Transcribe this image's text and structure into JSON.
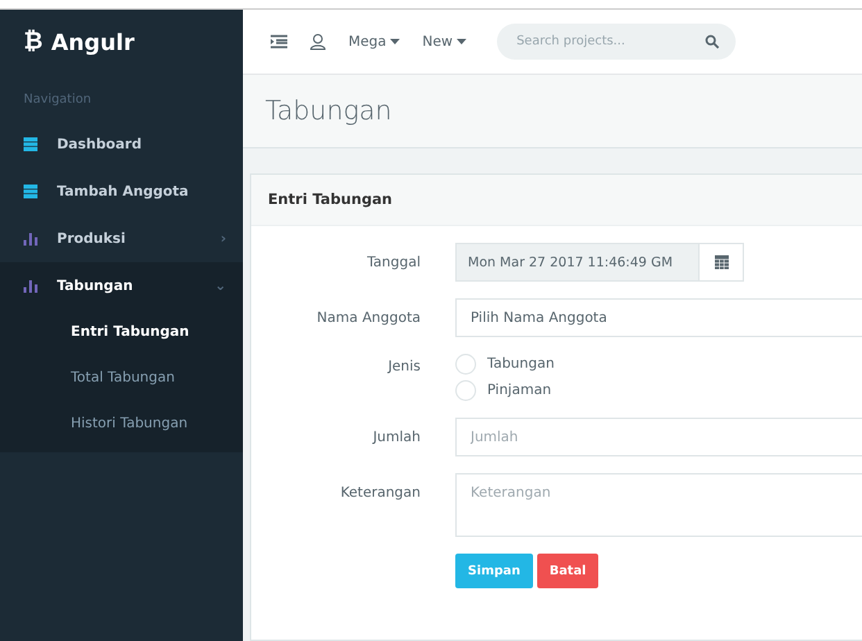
{
  "brand": {
    "logo": "₿",
    "name": "Angulr"
  },
  "sidebar": {
    "heading": "Navigation",
    "items": [
      {
        "label": "Dashboard",
        "kind": "calendar",
        "color": "#23b7e5",
        "expanded": false
      },
      {
        "label": "Tambah Anggota",
        "kind": "calendar",
        "color": "#23b7e5",
        "expanded": false
      },
      {
        "label": "Produksi",
        "kind": "chart",
        "color": "#7266ba",
        "expanded": false,
        "arrow": "›"
      },
      {
        "label": "Tabungan",
        "kind": "chart",
        "color": "#7266ba",
        "expanded": true,
        "arrow": "⌄",
        "children": [
          {
            "label": "Entri Tabungan",
            "selected": true
          },
          {
            "label": "Total Tabungan",
            "selected": false
          },
          {
            "label": "Histori Tabungan",
            "selected": false
          }
        ]
      }
    ]
  },
  "header": {
    "menus": [
      "Mega",
      "New"
    ],
    "search": {
      "placeholder": "Search projects..."
    }
  },
  "page": {
    "title": "Tabungan"
  },
  "panel": {
    "title": "Entri Tabungan",
    "fields": [
      {
        "kind": "date",
        "label": "Tanggal",
        "value": "Mon Mar 27 2017 11:46:49 GM"
      },
      {
        "kind": "text",
        "label": "Nama Anggota",
        "value": "Pilih Nama Anggota"
      },
      {
        "kind": "radio",
        "label": "Jenis",
        "options": [
          {
            "label": "Tabungan",
            "selected": false
          },
          {
            "label": "Pinjaman",
            "selected": false
          }
        ]
      },
      {
        "kind": "text",
        "label": "Jumlah",
        "placeholder": "Jumlah"
      },
      {
        "kind": "textarea",
        "label": "Keterangan",
        "placeholder": "Keterangan"
      }
    ],
    "buttons": [
      {
        "label": "Simpan",
        "kind": "primary"
      },
      {
        "label": "Batal",
        "kind": "danger"
      }
    ]
  }
}
